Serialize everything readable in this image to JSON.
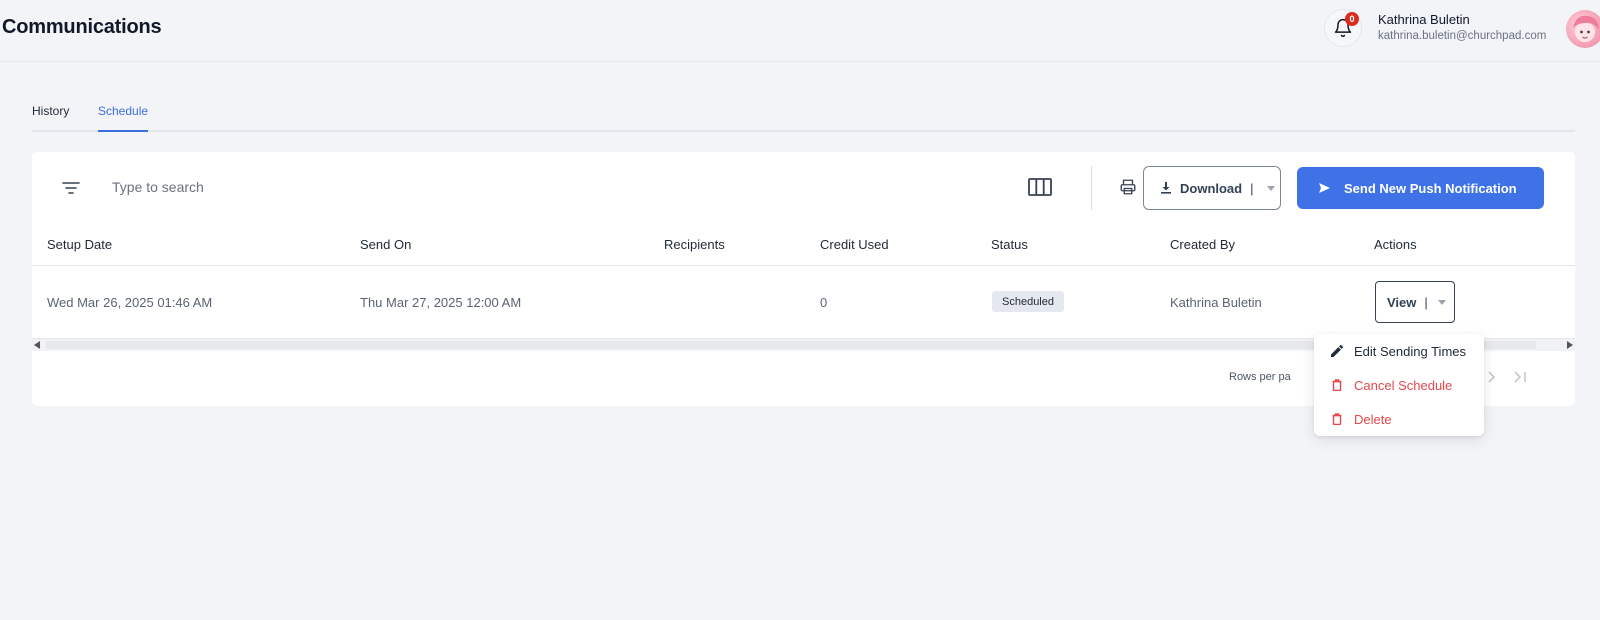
{
  "header": {
    "title": "Communications",
    "notification_count": "0",
    "user_name": "Kathrina Buletin",
    "user_email": "kathrina.buletin@churchpad.com"
  },
  "tabs": [
    {
      "label": "History",
      "active": false
    },
    {
      "label": "Schedule",
      "active": true
    }
  ],
  "toolbar": {
    "search_placeholder": "Type to search",
    "download_label": "Download",
    "download_separator": "|",
    "send_label": "Send New Push Notification"
  },
  "table": {
    "columns": [
      "Setup Date",
      "Send On",
      "Recipients",
      "Credit Used",
      "Status",
      "Created By",
      "Actions"
    ],
    "rows": [
      {
        "setup_date": "Wed Mar 26, 2025 01:46 AM",
        "send_on": "Thu Mar 27, 2025 12:00 AM",
        "recipients": "",
        "credit_used": "0",
        "status": "Scheduled",
        "created_by": "Kathrina Buletin",
        "action_label": "View",
        "action_separator": "|"
      }
    ]
  },
  "pagination": {
    "rows_per_page_label": "Rows per pa"
  },
  "action_menu": {
    "items": [
      {
        "label": "Edit Sending Times",
        "icon": "pencil-icon",
        "tone": "normal"
      },
      {
        "label": "Cancel Schedule",
        "icon": "trash-icon",
        "tone": "danger"
      },
      {
        "label": "Delete",
        "icon": "trash-icon",
        "tone": "danger"
      }
    ]
  },
  "colors": {
    "accent": "#3f72e6",
    "danger": "#e5484d",
    "badge": "#d92d20",
    "background": "#f2f4f8"
  }
}
